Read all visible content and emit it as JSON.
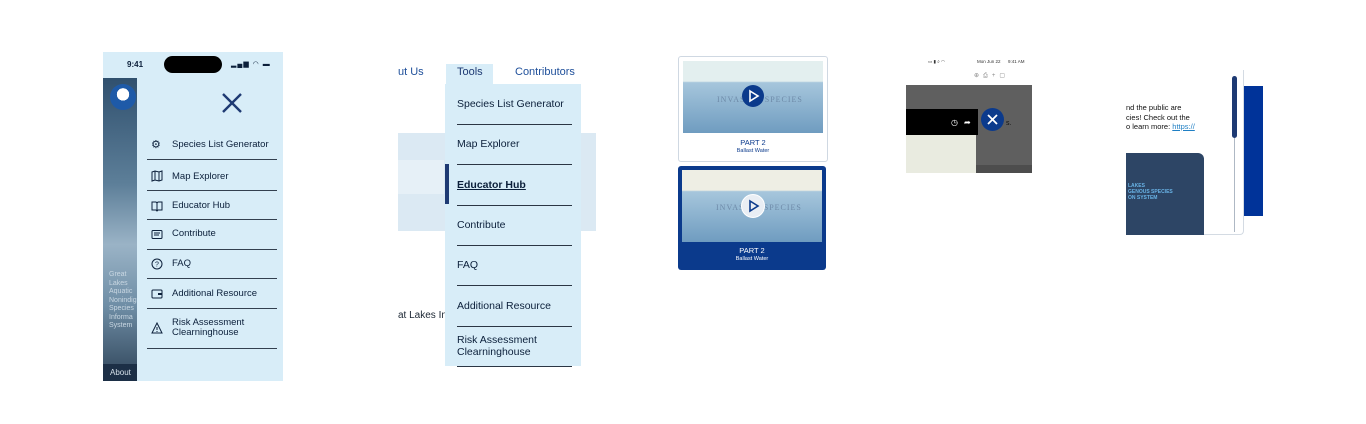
{
  "phone": {
    "status_time": "9:41",
    "side_text": [
      "Great",
      "Lakes",
      "Aquatic",
      "Nonindig",
      "Species",
      "Informa",
      "System"
    ],
    "about_tab": "About",
    "menu": [
      {
        "label": "Species List Generator",
        "icon": "gear-icon"
      },
      {
        "label": "Map Explorer",
        "icon": "map-icon"
      },
      {
        "label": "Educator Hub",
        "icon": "book-icon"
      },
      {
        "label": "Contribute",
        "icon": "message-icon"
      },
      {
        "label": "FAQ",
        "icon": "question-icon"
      },
      {
        "label": "Additional Resource",
        "icon": "wallet-icon"
      },
      {
        "label": "Risk Assessment Clearninghouse",
        "icon": "warning-icon"
      }
    ]
  },
  "desktop": {
    "nav": {
      "about": "ut Us",
      "tools": "Tools",
      "contributors": "Contributors"
    },
    "hero_fragment": "at Lakes In",
    "menu": [
      {
        "label": "Species List Generator"
      },
      {
        "label": "Map Explorer"
      },
      {
        "label": "Educator Hub",
        "active": true
      },
      {
        "label": "Contribute"
      },
      {
        "label": "FAQ"
      },
      {
        "label": "Additional Resource"
      },
      {
        "label": "Risk Assessment Clearninghouse"
      }
    ]
  },
  "videos": [
    {
      "title": "PART 2",
      "subtitle": "Ballast Water",
      "watermark": "INVASIVE SPECIES",
      "selected": false
    },
    {
      "title": "PART 2",
      "subtitle": "Ballast Water",
      "watermark": "INVASIVE SPECIES",
      "selected": true
    }
  ],
  "mac": {
    "menubar_date": "Mon Jun 22",
    "menubar_time": "9:41 AM",
    "video_fragment": "s."
  },
  "scroll_panel": {
    "lines": [
      "nd the public are",
      "cies! Check out the",
      "o learn more: "
    ],
    "link": "https://",
    "card_lines": [
      "LAKES",
      "GENOUS SPECIES",
      "ON SYSTEM"
    ]
  },
  "colors": {
    "menu_bg": "#d8edf8",
    "navy": "#0b1f3a",
    "brand_blue": "#003399",
    "link_blue": "#1f7fc4",
    "selected_card": "#0b3a8c"
  }
}
